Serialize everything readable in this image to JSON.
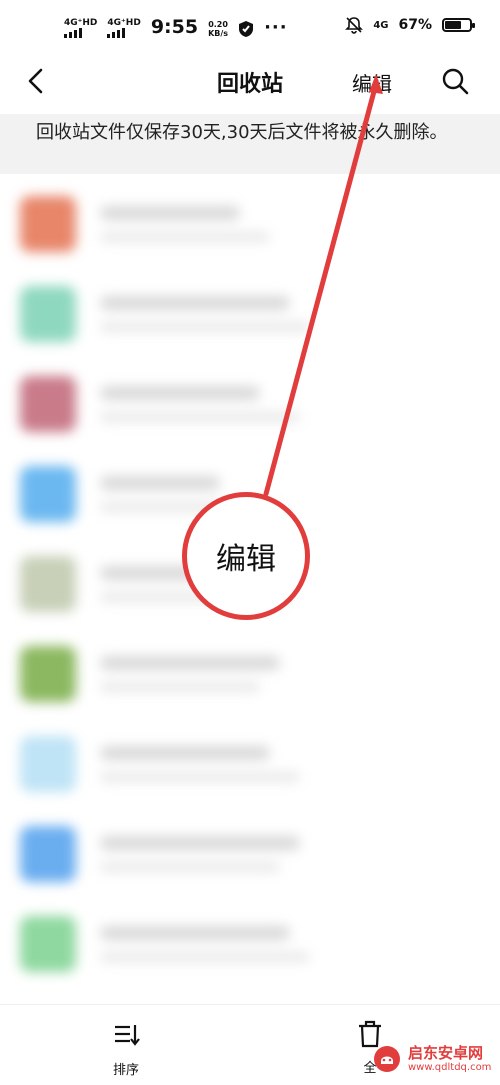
{
  "status_bar": {
    "network1": "4G⁺HD",
    "network2": "4G⁺HD",
    "time": "9:55",
    "speed_value": "0.20",
    "speed_unit": "KB/s",
    "more": "···",
    "network3": "4G",
    "battery": "67%",
    "battery_level": 0.67
  },
  "header": {
    "title": "回收站",
    "edit": "编辑"
  },
  "notice": "回收站文件仅保存30天,30天后文件将被永久删除。",
  "list": {
    "items": [
      {
        "thumb_color": "#e8866a"
      },
      {
        "thumb_color": "#8fd8c0"
      },
      {
        "thumb_color": "#c97b8a"
      },
      {
        "thumb_color": "#6bb8f0"
      },
      {
        "thumb_color": "#c8d0b8"
      },
      {
        "thumb_color": "#8bb860"
      },
      {
        "thumb_color": "#bfe4f6"
      },
      {
        "thumb_color": "#6aaef0"
      },
      {
        "thumb_color": "#8fd8a0"
      }
    ]
  },
  "bottom": {
    "sort_label": "排序",
    "delete_all_label": "全"
  },
  "annotation": {
    "callout_text": "编辑",
    "color": "#e23d3d"
  },
  "watermark": {
    "text": "启东安卓网",
    "url": "www.qdltdq.com"
  }
}
